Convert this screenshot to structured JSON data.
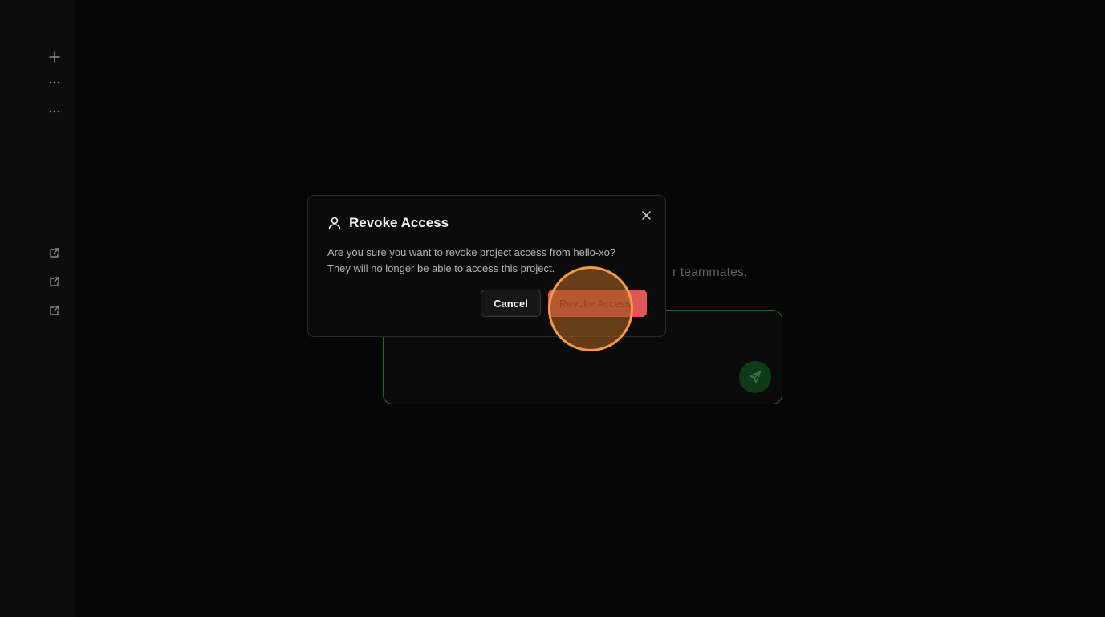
{
  "background": {
    "subtitle_fragment": "r teammates."
  },
  "sidebar": {
    "icons": [
      {
        "name": "plus-icon"
      },
      {
        "name": "more-horizontal-icon"
      },
      {
        "name": "more-horizontal-icon"
      },
      {
        "name": "external-link-icon"
      },
      {
        "name": "external-link-icon"
      },
      {
        "name": "external-link-icon"
      }
    ]
  },
  "modal": {
    "title": "Revoke Access",
    "icon": "user-icon",
    "body_line1": "Are you sure you want to revoke project access from hello-xo?",
    "body_line2": "They will no longer be able to access this project.",
    "cancel_label": "Cancel",
    "revoke_label": "Revoke Access",
    "close_icon": "close-icon"
  },
  "colors": {
    "background": "#050505",
    "sidebar": "#0d0d0d",
    "modal_bg": "#0b0b0b",
    "danger": "#e05656",
    "chat_border": "#1f6b2a",
    "send_button": "#0f3a18",
    "click_indicator": "#f59a45"
  }
}
